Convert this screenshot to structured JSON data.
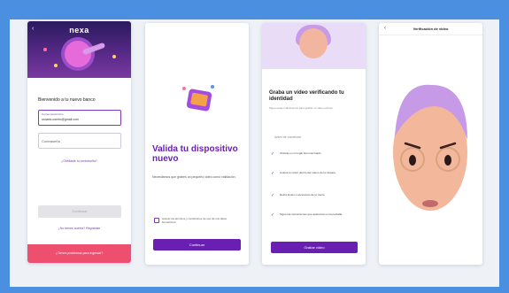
{
  "screen1": {
    "brand": "nexa",
    "back_icon": "chevron-left-icon",
    "heading": "Bienvenido a tu nuevo banco",
    "email_label": "Correo electrónico",
    "email_value": "usuario.correo@gmail.com",
    "password_placeholder": "Contraseña",
    "forgot_link": "¿Olvidaste tu contraseña?",
    "login_button": "Continuar",
    "register_link": "¿No tienes cuenta? Regístrate",
    "footer_text": "¿Tienes problemas para ingresar?"
  },
  "screen2": {
    "title": "Valida tu dispositivo nuevo",
    "description": "Necesitamos que grabes un pequeño video como validación.",
    "consent": "Acepto los términos y condiciones de uso de mis datos biométricos.",
    "button": "Continuar"
  },
  "screen3": {
    "title": "Graba un video verificando tu identidad",
    "subtitle": "Sigue estas indicaciones para grabar un video exitoso.",
    "section_label": "Antes de comenzar",
    "items": [
      "Ubícate en un lugar bien iluminado.",
      "Coloca tu rostro dentro del marco de la cámara.",
      "Retira lentes o accesorios de tu rostro.",
      "Sigue las instrucciones que aparezcan en la pantalla."
    ],
    "button": "Grabar video"
  },
  "screen4": {
    "back_icon": "chevron-left-icon",
    "title": "Verificación de video"
  },
  "colors": {
    "primary": "#6a1fb3",
    "accent": "#ef4f6f",
    "background": "#4a8fe0"
  }
}
